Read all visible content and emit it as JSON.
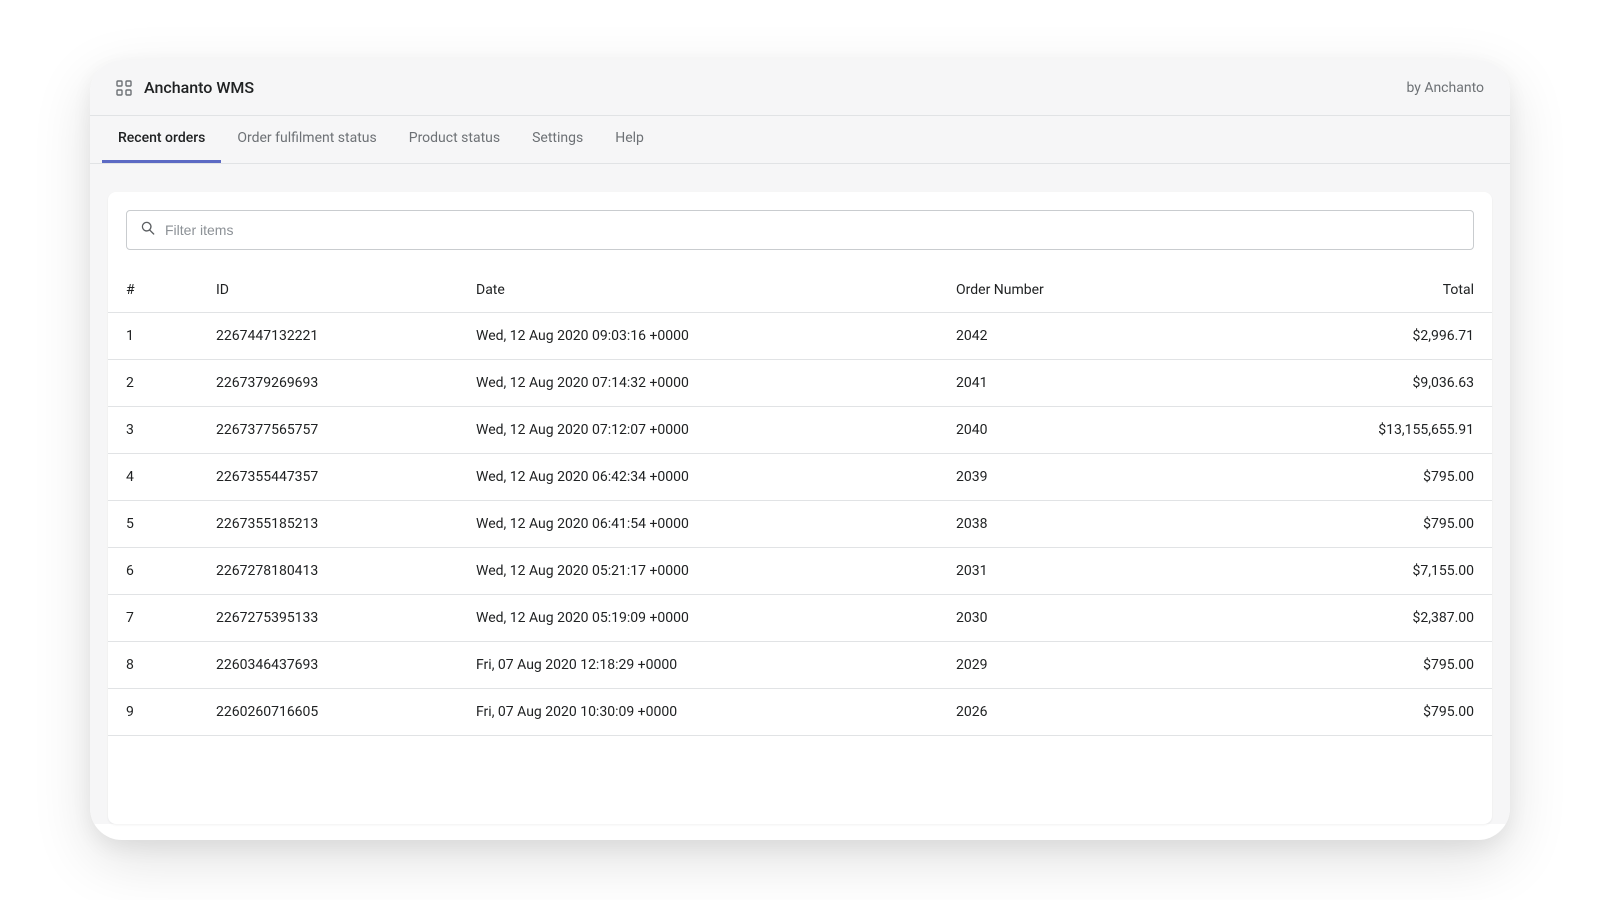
{
  "header": {
    "app_title": "Anchanto WMS",
    "by_label": "by Anchanto"
  },
  "tabs": [
    {
      "label": "Recent orders",
      "active": true
    },
    {
      "label": "Order fulfilment status",
      "active": false
    },
    {
      "label": "Product status",
      "active": false
    },
    {
      "label": "Settings",
      "active": false
    },
    {
      "label": "Help",
      "active": false
    }
  ],
  "filter": {
    "placeholder": "Filter items"
  },
  "table": {
    "columns": [
      "#",
      "ID",
      "Date",
      "Order Number",
      "Total"
    ],
    "rows": [
      {
        "num": "1",
        "id": "2267447132221",
        "date": "Wed, 12 Aug 2020 09:03:16 +0000",
        "order_number": "2042",
        "total": "$2,996.71"
      },
      {
        "num": "2",
        "id": "2267379269693",
        "date": "Wed, 12 Aug 2020 07:14:32 +0000",
        "order_number": "2041",
        "total": "$9,036.63"
      },
      {
        "num": "3",
        "id": "2267377565757",
        "date": "Wed, 12 Aug 2020 07:12:07 +0000",
        "order_number": "2040",
        "total": "$13,155,655.91"
      },
      {
        "num": "4",
        "id": "2267355447357",
        "date": "Wed, 12 Aug 2020 06:42:34 +0000",
        "order_number": "2039",
        "total": "$795.00"
      },
      {
        "num": "5",
        "id": "2267355185213",
        "date": "Wed, 12 Aug 2020 06:41:54 +0000",
        "order_number": "2038",
        "total": "$795.00"
      },
      {
        "num": "6",
        "id": "2267278180413",
        "date": "Wed, 12 Aug 2020 05:21:17 +0000",
        "order_number": "2031",
        "total": "$7,155.00"
      },
      {
        "num": "7",
        "id": "2267275395133",
        "date": "Wed, 12 Aug 2020 05:19:09 +0000",
        "order_number": "2030",
        "total": "$2,387.00"
      },
      {
        "num": "8",
        "id": "2260346437693",
        "date": "Fri, 07 Aug 2020 12:18:29 +0000",
        "order_number": "2029",
        "total": "$795.00"
      },
      {
        "num": "9",
        "id": "2260260716605",
        "date": "Fri, 07 Aug 2020 10:30:09 +0000",
        "order_number": "2026",
        "total": "$795.00"
      }
    ]
  }
}
